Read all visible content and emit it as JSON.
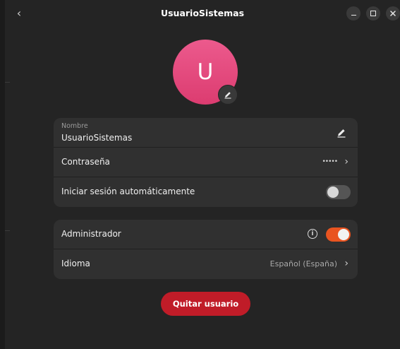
{
  "window": {
    "title": "UsuarioSistemas",
    "back_glyph": "‹",
    "close_glyph": "✕"
  },
  "avatar": {
    "initial": "U",
    "edit_icon": "pencil-icon"
  },
  "account": {
    "name_caption": "Nombre",
    "name_value": "UsuarioSistemas",
    "password_label": "Contraseña",
    "password_mask": "•••••",
    "autologin_label": "Iniciar sesión automáticamente",
    "autologin_enabled": false
  },
  "settings": {
    "admin_label": "Administrador",
    "admin_enabled": true,
    "info_glyph": "i",
    "language_label": "Idioma",
    "language_value": "Español (España)",
    "chevron_glyph": "›"
  },
  "actions": {
    "remove_label": "Quitar usuario"
  },
  "colors": {
    "accent": "#e95420",
    "destructive": "#c01c28",
    "avatar": "#e2487c"
  }
}
